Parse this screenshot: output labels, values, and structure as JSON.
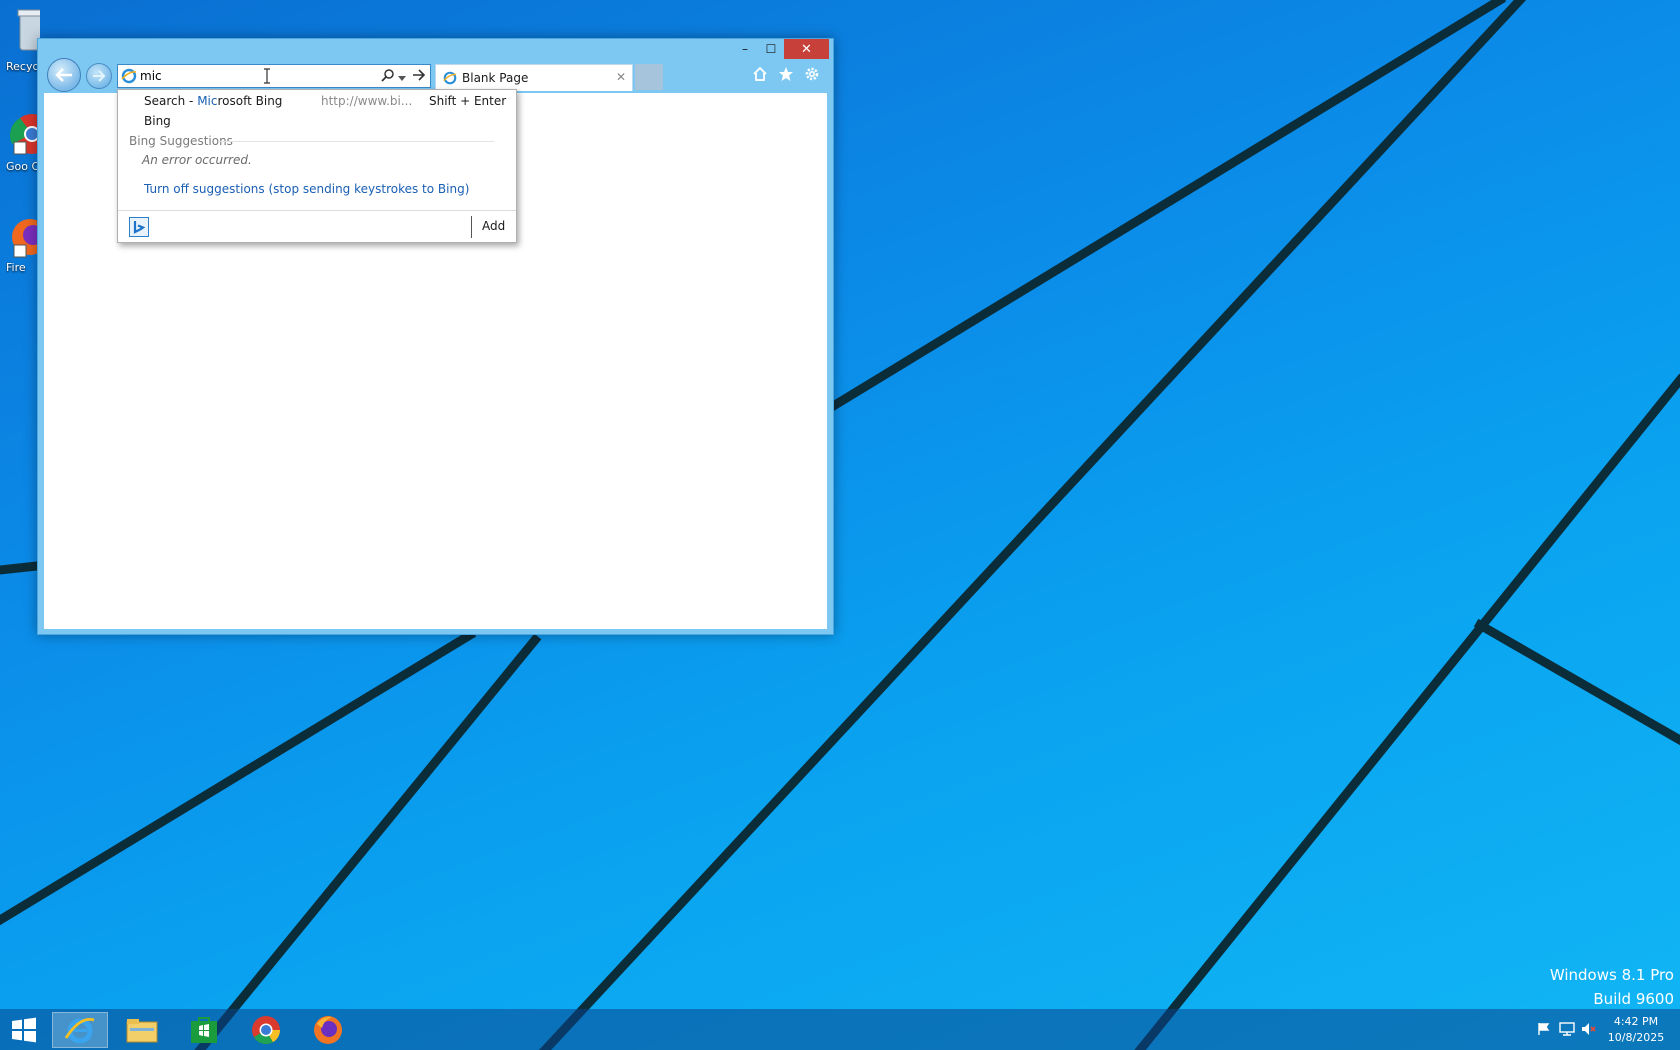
{
  "desktop": {
    "icons": [
      {
        "label": "Recyc",
        "icon": "recycle-bin-icon"
      },
      {
        "label": "Goo Chro",
        "icon": "chrome-icon"
      },
      {
        "label": "Fire",
        "icon": "firefox-icon"
      }
    ],
    "watermark": {
      "line1": "Windows 8.1 Pro",
      "line2": "Build 9600"
    }
  },
  "ie": {
    "title_buttons": {
      "minimize": "–",
      "maximize": "☐",
      "close": "✕"
    },
    "address": {
      "value": "mic"
    },
    "tab": {
      "title": "Blank Page",
      "close": "✕"
    },
    "dropdown": {
      "search_prefix": "Search - ",
      "search_highlight": "Mic",
      "search_rest": "rosoft Bing",
      "search_url": "http://www.bi...",
      "search_shortcut": "Shift + Enter",
      "provider": "Bing",
      "section_header": "Bing Suggestions",
      "error": "An error occurred.",
      "turn_off": "Turn off suggestions (stop sending keystrokes to Bing)",
      "add": "Add"
    }
  },
  "taskbar": {
    "apps": [
      {
        "name": "internet-explorer",
        "active": true
      },
      {
        "name": "file-explorer",
        "active": false
      },
      {
        "name": "store",
        "active": false
      },
      {
        "name": "chrome",
        "active": false
      },
      {
        "name": "firefox",
        "active": false
      }
    ],
    "clock": {
      "time": "4:42 PM",
      "date": "10/8/2025"
    }
  },
  "colors": {
    "accent": "#0a8ae8",
    "link": "#1a5fb4",
    "close": "#c7403a"
  }
}
